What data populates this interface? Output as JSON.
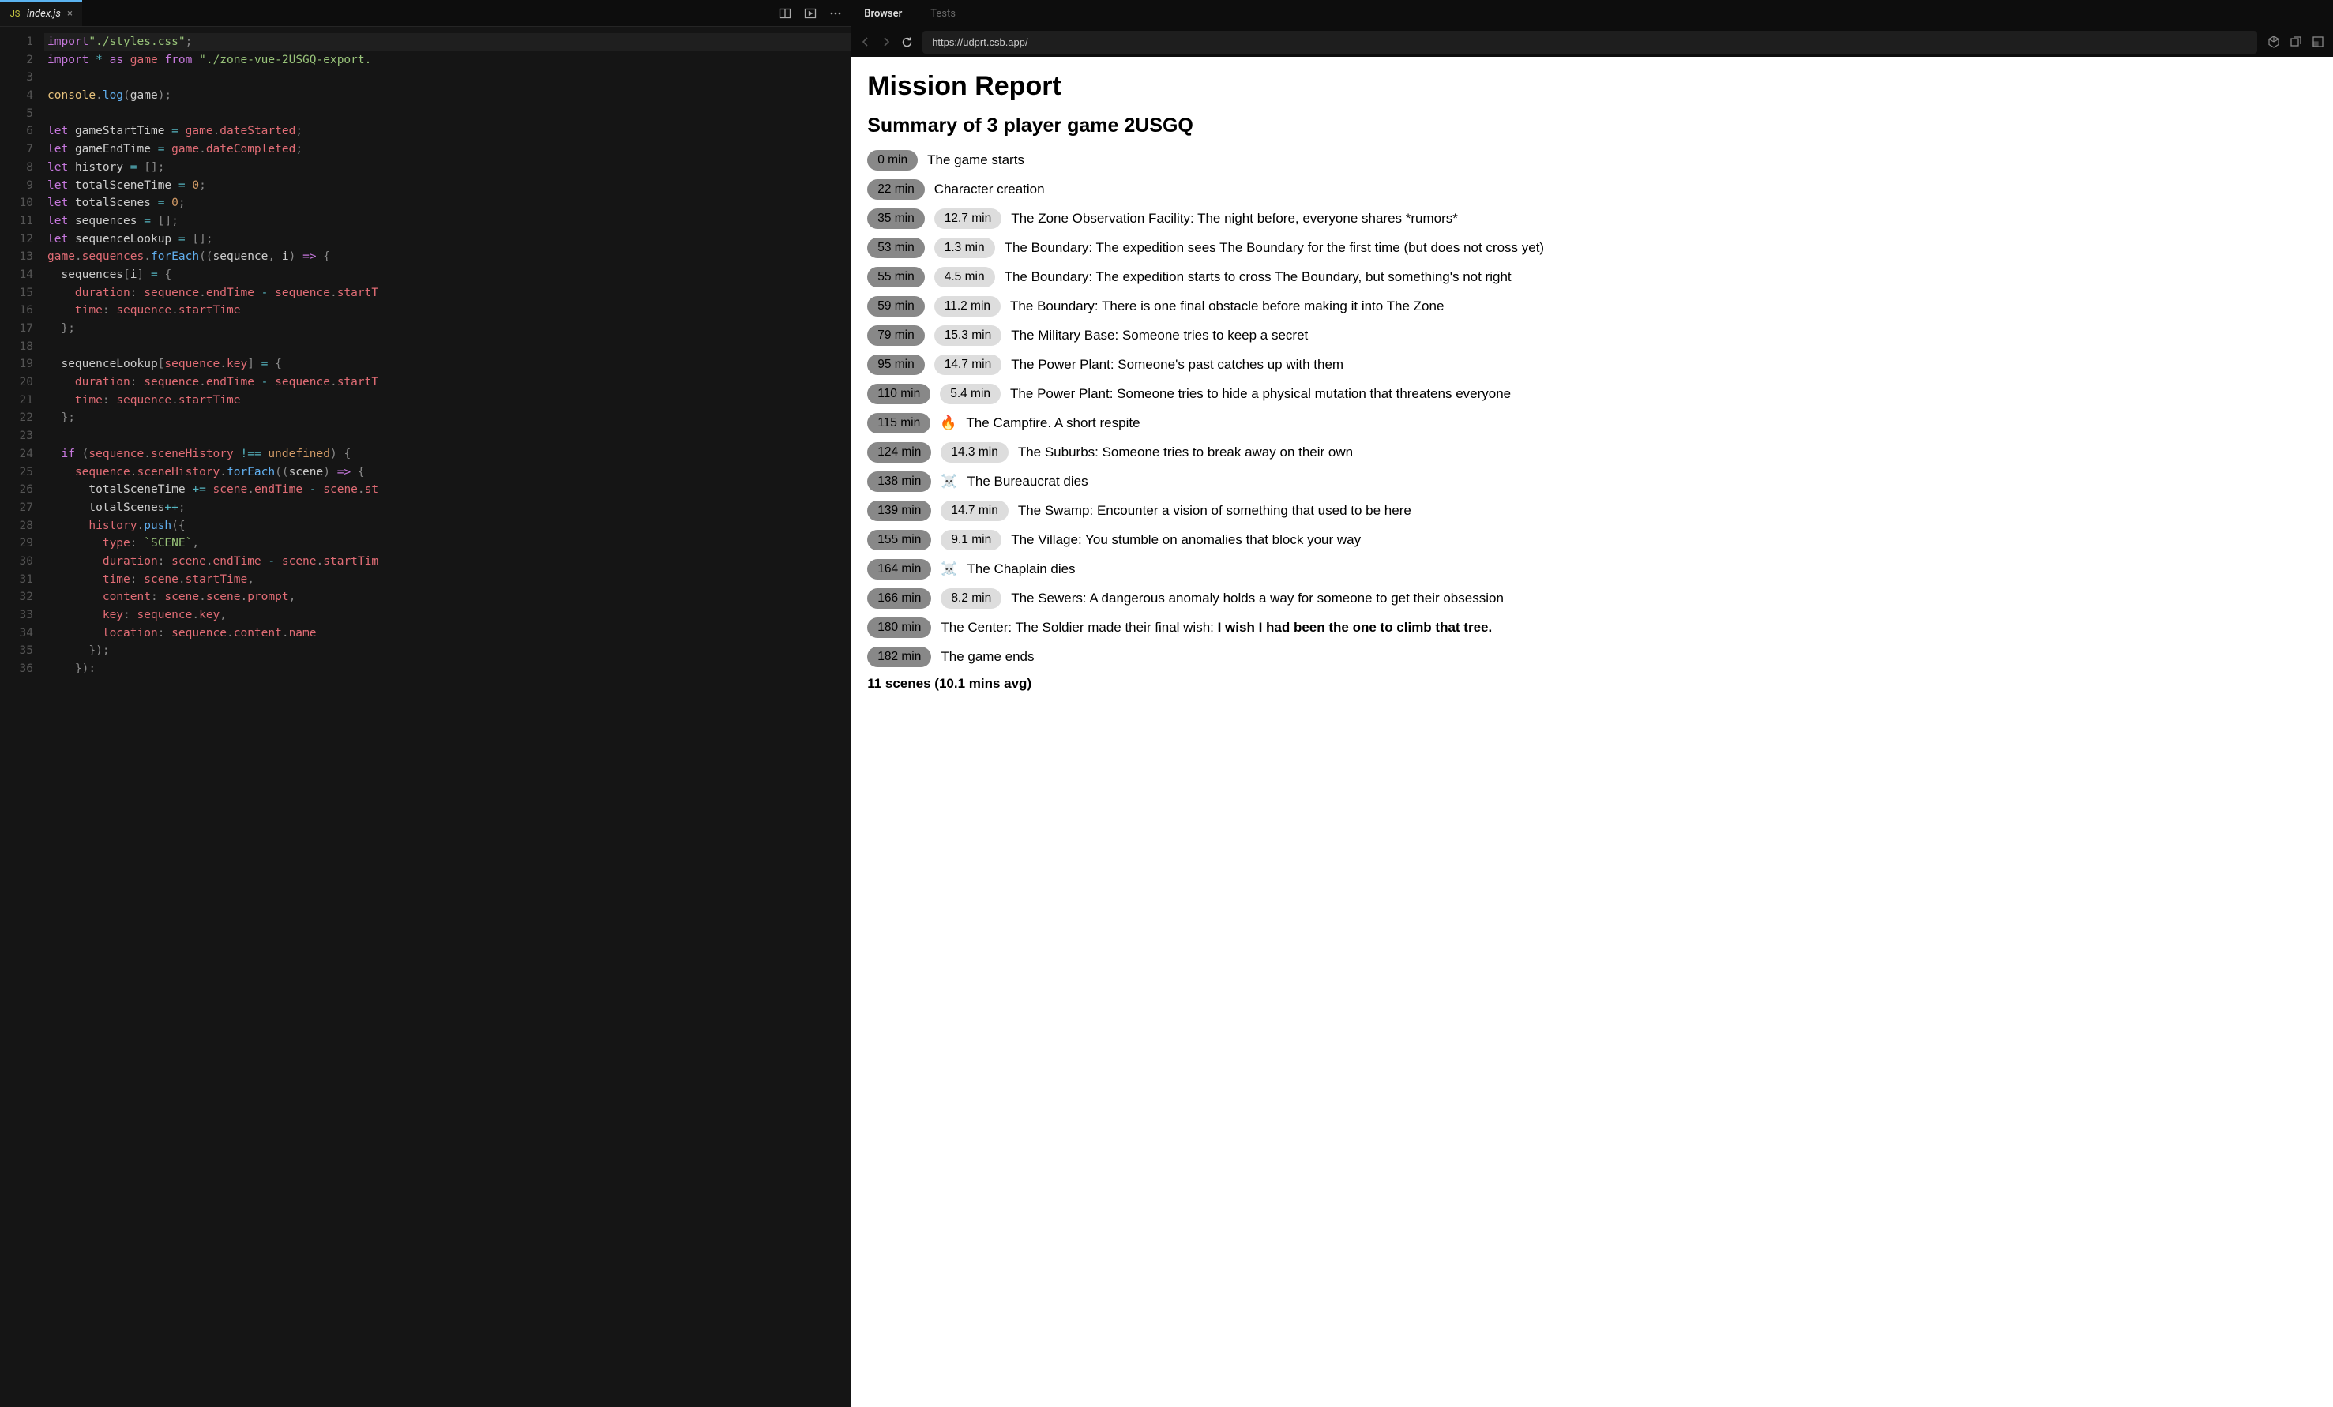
{
  "editor": {
    "tab": {
      "filename": "index.js"
    },
    "lines": [
      [
        [
          "kw",
          "import"
        ],
        [
          "",
          ""
        ],
        [
          "str",
          "\"./styles.css\""
        ],
        [
          "punc",
          ";"
        ]
      ],
      [
        [
          "kw",
          "import"
        ],
        [
          "",
          " "
        ],
        [
          "op",
          "*"
        ],
        [
          "",
          " "
        ],
        [
          "kw",
          "as"
        ],
        [
          "",
          " "
        ],
        [
          "var",
          "game"
        ],
        [
          "",
          " "
        ],
        [
          "kw",
          "from"
        ],
        [
          "",
          " "
        ],
        [
          "str",
          "\"./zone-vue-2USGQ-export."
        ]
      ],
      [],
      [
        [
          "obj",
          "console"
        ],
        [
          "punc",
          "."
        ],
        [
          "fn",
          "log"
        ],
        [
          "punc",
          "("
        ],
        [
          "id",
          "game"
        ],
        [
          "punc",
          ");"
        ]
      ],
      [],
      [
        [
          "kw",
          "let"
        ],
        [
          "",
          " "
        ],
        [
          "id",
          "gameStartTime"
        ],
        [
          "",
          " "
        ],
        [
          "op",
          "="
        ],
        [
          "",
          " "
        ],
        [
          "var",
          "game"
        ],
        [
          "punc",
          "."
        ],
        [
          "prop",
          "dateStarted"
        ],
        [
          "punc",
          ";"
        ]
      ],
      [
        [
          "kw",
          "let"
        ],
        [
          "",
          " "
        ],
        [
          "id",
          "gameEndTime"
        ],
        [
          "",
          " "
        ],
        [
          "op",
          "="
        ],
        [
          "",
          " "
        ],
        [
          "var",
          "game"
        ],
        [
          "punc",
          "."
        ],
        [
          "prop",
          "dateCompleted"
        ],
        [
          "punc",
          ";"
        ]
      ],
      [
        [
          "kw",
          "let"
        ],
        [
          "",
          " "
        ],
        [
          "id",
          "history"
        ],
        [
          "",
          " "
        ],
        [
          "op",
          "="
        ],
        [
          "",
          " "
        ],
        [
          "punc",
          "[];"
        ]
      ],
      [
        [
          "kw",
          "let"
        ],
        [
          "",
          " "
        ],
        [
          "id",
          "totalSceneTime"
        ],
        [
          "",
          " "
        ],
        [
          "op",
          "="
        ],
        [
          "",
          " "
        ],
        [
          "num",
          "0"
        ],
        [
          "punc",
          ";"
        ]
      ],
      [
        [
          "kw",
          "let"
        ],
        [
          "",
          " "
        ],
        [
          "id",
          "totalScenes"
        ],
        [
          "",
          " "
        ],
        [
          "op",
          "="
        ],
        [
          "",
          " "
        ],
        [
          "num",
          "0"
        ],
        [
          "punc",
          ";"
        ]
      ],
      [
        [
          "kw",
          "let"
        ],
        [
          "",
          " "
        ],
        [
          "id",
          "sequences"
        ],
        [
          "",
          " "
        ],
        [
          "op",
          "="
        ],
        [
          "",
          " "
        ],
        [
          "punc",
          "[];"
        ]
      ],
      [
        [
          "kw",
          "let"
        ],
        [
          "",
          " "
        ],
        [
          "id",
          "sequenceLookup"
        ],
        [
          "",
          " "
        ],
        [
          "op",
          "="
        ],
        [
          "",
          " "
        ],
        [
          "punc",
          "[];"
        ]
      ],
      [
        [
          "var",
          "game"
        ],
        [
          "punc",
          "."
        ],
        [
          "prop",
          "sequences"
        ],
        [
          "punc",
          "."
        ],
        [
          "fn",
          "forEach"
        ],
        [
          "punc",
          "(("
        ],
        [
          "id",
          "sequence"
        ],
        [
          "punc",
          ", "
        ],
        [
          "id",
          "i"
        ],
        [
          "punc",
          ") "
        ],
        [
          "kw",
          "=>"
        ],
        [
          "punc",
          " {"
        ]
      ],
      [
        [
          "",
          "  "
        ],
        [
          "id",
          "sequences"
        ],
        [
          "punc",
          "["
        ],
        [
          "id",
          "i"
        ],
        [
          "punc",
          "] "
        ],
        [
          "op",
          "="
        ],
        [
          "punc",
          " {"
        ]
      ],
      [
        [
          "",
          "    "
        ],
        [
          "prop",
          "duration"
        ],
        [
          "punc",
          ": "
        ],
        [
          "var",
          "sequence"
        ],
        [
          "punc",
          "."
        ],
        [
          "prop",
          "endTime"
        ],
        [
          "",
          " "
        ],
        [
          "op",
          "-"
        ],
        [
          "",
          " "
        ],
        [
          "var",
          "sequence"
        ],
        [
          "punc",
          "."
        ],
        [
          "prop",
          "startT"
        ]
      ],
      [
        [
          "",
          "    "
        ],
        [
          "prop",
          "time"
        ],
        [
          "punc",
          ": "
        ],
        [
          "var",
          "sequence"
        ],
        [
          "punc",
          "."
        ],
        [
          "prop",
          "startTime"
        ]
      ],
      [
        [
          "",
          "  "
        ],
        [
          "punc",
          "};"
        ]
      ],
      [],
      [
        [
          "",
          "  "
        ],
        [
          "id",
          "sequenceLookup"
        ],
        [
          "punc",
          "["
        ],
        [
          "var",
          "sequence"
        ],
        [
          "punc",
          "."
        ],
        [
          "prop",
          "key"
        ],
        [
          "punc",
          "] "
        ],
        [
          "op",
          "="
        ],
        [
          "punc",
          " {"
        ]
      ],
      [
        [
          "",
          "    "
        ],
        [
          "prop",
          "duration"
        ],
        [
          "punc",
          ": "
        ],
        [
          "var",
          "sequence"
        ],
        [
          "punc",
          "."
        ],
        [
          "prop",
          "endTime"
        ],
        [
          "",
          " "
        ],
        [
          "op",
          "-"
        ],
        [
          "",
          " "
        ],
        [
          "var",
          "sequence"
        ],
        [
          "punc",
          "."
        ],
        [
          "prop",
          "startT"
        ]
      ],
      [
        [
          "",
          "    "
        ],
        [
          "prop",
          "time"
        ],
        [
          "punc",
          ": "
        ],
        [
          "var",
          "sequence"
        ],
        [
          "punc",
          "."
        ],
        [
          "prop",
          "startTime"
        ]
      ],
      [
        [
          "",
          "  "
        ],
        [
          "punc",
          "};"
        ]
      ],
      [],
      [
        [
          "",
          "  "
        ],
        [
          "kw",
          "if"
        ],
        [
          "punc",
          " ("
        ],
        [
          "var",
          "sequence"
        ],
        [
          "punc",
          "."
        ],
        [
          "prop",
          "sceneHistory"
        ],
        [
          "",
          " "
        ],
        [
          "op",
          "!=="
        ],
        [
          "",
          " "
        ],
        [
          "num",
          "undefined"
        ],
        [
          "punc",
          ") {"
        ]
      ],
      [
        [
          "",
          "    "
        ],
        [
          "var",
          "sequence"
        ],
        [
          "punc",
          "."
        ],
        [
          "prop",
          "sceneHistory"
        ],
        [
          "punc",
          "."
        ],
        [
          "fn",
          "forEach"
        ],
        [
          "punc",
          "(("
        ],
        [
          "id",
          "scene"
        ],
        [
          "punc",
          ") "
        ],
        [
          "kw",
          "=>"
        ],
        [
          "punc",
          " {"
        ]
      ],
      [
        [
          "",
          "      "
        ],
        [
          "id",
          "totalSceneTime"
        ],
        [
          "",
          " "
        ],
        [
          "op",
          "+="
        ],
        [
          "",
          " "
        ],
        [
          "var",
          "scene"
        ],
        [
          "punc",
          "."
        ],
        [
          "prop",
          "endTime"
        ],
        [
          "",
          " "
        ],
        [
          "op",
          "-"
        ],
        [
          "",
          " "
        ],
        [
          "var",
          "scene"
        ],
        [
          "punc",
          "."
        ],
        [
          "prop",
          "st"
        ]
      ],
      [
        [
          "",
          "      "
        ],
        [
          "id",
          "totalScenes"
        ],
        [
          "op",
          "++"
        ],
        [
          "punc",
          ";"
        ]
      ],
      [
        [
          "",
          "      "
        ],
        [
          "var",
          "history"
        ],
        [
          "punc",
          "."
        ],
        [
          "fn",
          "push"
        ],
        [
          "punc",
          "({"
        ]
      ],
      [
        [
          "",
          "        "
        ],
        [
          "prop",
          "type"
        ],
        [
          "punc",
          ": "
        ],
        [
          "str",
          "`SCENE`"
        ],
        [
          "punc",
          ","
        ]
      ],
      [
        [
          "",
          "        "
        ],
        [
          "prop",
          "duration"
        ],
        [
          "punc",
          ": "
        ],
        [
          "var",
          "scene"
        ],
        [
          "punc",
          "."
        ],
        [
          "prop",
          "endTime"
        ],
        [
          "",
          " "
        ],
        [
          "op",
          "-"
        ],
        [
          "",
          " "
        ],
        [
          "var",
          "scene"
        ],
        [
          "punc",
          "."
        ],
        [
          "prop",
          "startTim"
        ]
      ],
      [
        [
          "",
          "        "
        ],
        [
          "prop",
          "time"
        ],
        [
          "punc",
          ": "
        ],
        [
          "var",
          "scene"
        ],
        [
          "punc",
          "."
        ],
        [
          "prop",
          "startTime"
        ],
        [
          "punc",
          ","
        ]
      ],
      [
        [
          "",
          "        "
        ],
        [
          "prop",
          "content"
        ],
        [
          "punc",
          ": "
        ],
        [
          "var",
          "scene"
        ],
        [
          "punc",
          "."
        ],
        [
          "prop",
          "scene"
        ],
        [
          "punc",
          "."
        ],
        [
          "prop",
          "prompt"
        ],
        [
          "punc",
          ","
        ]
      ],
      [
        [
          "",
          "        "
        ],
        [
          "prop",
          "key"
        ],
        [
          "punc",
          ": "
        ],
        [
          "var",
          "sequence"
        ],
        [
          "punc",
          "."
        ],
        [
          "prop",
          "key"
        ],
        [
          "punc",
          ","
        ]
      ],
      [
        [
          "",
          "        "
        ],
        [
          "prop",
          "location"
        ],
        [
          "punc",
          ": "
        ],
        [
          "var",
          "sequence"
        ],
        [
          "punc",
          "."
        ],
        [
          "prop",
          "content"
        ],
        [
          "punc",
          "."
        ],
        [
          "prop",
          "name"
        ]
      ],
      [
        [
          "",
          "      "
        ],
        [
          "punc",
          "});"
        ]
      ],
      [
        [
          "",
          "    "
        ],
        [
          "punc",
          "}):"
        ]
      ]
    ]
  },
  "browserTabs": {
    "active": "Browser",
    "inactive": "Tests"
  },
  "addressBar": {
    "url": "https://udprt.csb.app/"
  },
  "page": {
    "title": "Mission Report",
    "subtitle": "Summary of 3 player game 2USGQ",
    "events": [
      {
        "time": "0 min",
        "dur": null,
        "emoji": null,
        "text": "The game starts"
      },
      {
        "time": "22 min",
        "dur": null,
        "emoji": null,
        "text": "Character creation"
      },
      {
        "time": "35 min",
        "dur": "12.7 min",
        "emoji": null,
        "text": "The Zone Observation Facility: The night before, everyone shares *rumors*"
      },
      {
        "time": "53 min",
        "dur": "1.3 min",
        "emoji": null,
        "text": "The Boundary: The expedition sees The Boundary for the first time (but does not cross yet)"
      },
      {
        "time": "55 min",
        "dur": "4.5 min",
        "emoji": null,
        "text": "The Boundary: The expedition starts to cross The Boundary, but something's not right"
      },
      {
        "time": "59 min",
        "dur": "11.2 min",
        "emoji": null,
        "text": "The Boundary: There is one final obstacle before making it into The Zone"
      },
      {
        "time": "79 min",
        "dur": "15.3 min",
        "emoji": null,
        "text": "The Military Base: Someone tries to keep a secret"
      },
      {
        "time": "95 min",
        "dur": "14.7 min",
        "emoji": null,
        "text": "The Power Plant: Someone's past catches up with them"
      },
      {
        "time": "110 min",
        "dur": "5.4 min",
        "emoji": null,
        "text": "The Power Plant: Someone tries to hide a physical mutation that threatens everyone"
      },
      {
        "time": "115 min",
        "dur": null,
        "emoji": "🔥",
        "text": "The Campfire. A short respite"
      },
      {
        "time": "124 min",
        "dur": "14.3 min",
        "emoji": null,
        "text": "The Suburbs: Someone tries to break away on their own"
      },
      {
        "time": "138 min",
        "dur": null,
        "emoji": "☠️",
        "text": "The Bureaucrat dies"
      },
      {
        "time": "139 min",
        "dur": "14.7 min",
        "emoji": null,
        "text": "The Swamp: Encounter a vision of something that used to be here"
      },
      {
        "time": "155 min",
        "dur": "9.1 min",
        "emoji": null,
        "text": "The Village: You stumble on anomalies that block your way"
      },
      {
        "time": "164 min",
        "dur": null,
        "emoji": "☠️",
        "text": "The Chaplain dies"
      },
      {
        "time": "166 min",
        "dur": "8.2 min",
        "emoji": null,
        "text": "The Sewers: A dangerous anomaly holds a way for someone to get their obsession"
      },
      {
        "time": "180 min",
        "dur": null,
        "emoji": null,
        "text": "The Center: The Soldier made their final wish: ",
        "bold": "I wish I had been the one to climb that tree."
      },
      {
        "time": "182 min",
        "dur": null,
        "emoji": null,
        "text": "The game ends"
      }
    ],
    "summary": "11 scenes (10.1 mins avg)"
  }
}
